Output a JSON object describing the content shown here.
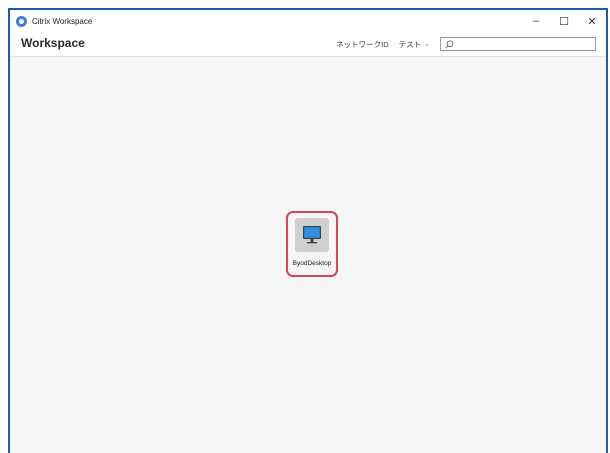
{
  "window": {
    "title": "Citrix Workspace",
    "controls": {
      "minimize": "–",
      "maximize": "☐",
      "close": "✕"
    }
  },
  "header": {
    "brand": "Workspace",
    "network_id": "ネットワークID",
    "user": "テスト",
    "user_chevron": "⌄",
    "search": {
      "placeholder": "",
      "value": ""
    }
  },
  "apps": [
    {
      "label": "ByodDesktop",
      "icon": "desktop-monitor-icon"
    }
  ],
  "colors": {
    "window_border": "#1e5ba8",
    "highlight": "#d8455a",
    "monitor_screen": "#2f8fe0"
  }
}
